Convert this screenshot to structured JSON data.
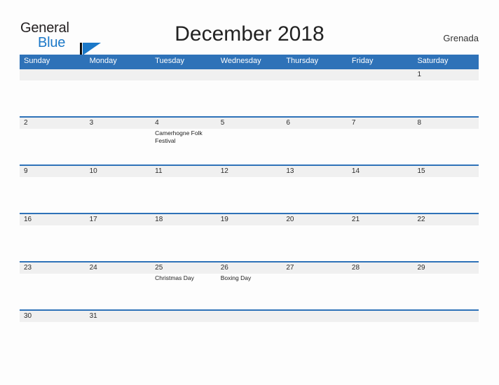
{
  "brand": {
    "word_one": "General",
    "word_two": "Blue",
    "flag_icon": "blue-flag-triangle-icon",
    "accent_color": "#1b78c8"
  },
  "header": {
    "title": "December 2018",
    "country": "Grenada"
  },
  "colors": {
    "header_blue": "#2e72b8",
    "number_band_gray": "#f0f0f0",
    "cell_white": "#fdfdfd",
    "text_dark": "#1c1c1c"
  },
  "calendar": {
    "weekday_headers": [
      "Sunday",
      "Monday",
      "Tuesday",
      "Wednesday",
      "Thursday",
      "Friday",
      "Saturday"
    ],
    "weeks": [
      {
        "short": false,
        "days": [
          {
            "number": "",
            "event": ""
          },
          {
            "number": "",
            "event": ""
          },
          {
            "number": "",
            "event": ""
          },
          {
            "number": "",
            "event": ""
          },
          {
            "number": "",
            "event": ""
          },
          {
            "number": "",
            "event": ""
          },
          {
            "number": "1",
            "event": ""
          }
        ]
      },
      {
        "short": false,
        "days": [
          {
            "number": "2",
            "event": ""
          },
          {
            "number": "3",
            "event": ""
          },
          {
            "number": "4",
            "event": "Camerhogne Folk Festival"
          },
          {
            "number": "5",
            "event": ""
          },
          {
            "number": "6",
            "event": ""
          },
          {
            "number": "7",
            "event": ""
          },
          {
            "number": "8",
            "event": ""
          }
        ]
      },
      {
        "short": false,
        "days": [
          {
            "number": "9",
            "event": ""
          },
          {
            "number": "10",
            "event": ""
          },
          {
            "number": "11",
            "event": ""
          },
          {
            "number": "12",
            "event": ""
          },
          {
            "number": "13",
            "event": ""
          },
          {
            "number": "14",
            "event": ""
          },
          {
            "number": "15",
            "event": ""
          }
        ]
      },
      {
        "short": false,
        "days": [
          {
            "number": "16",
            "event": ""
          },
          {
            "number": "17",
            "event": ""
          },
          {
            "number": "18",
            "event": ""
          },
          {
            "number": "19",
            "event": ""
          },
          {
            "number": "20",
            "event": ""
          },
          {
            "number": "21",
            "event": ""
          },
          {
            "number": "22",
            "event": ""
          }
        ]
      },
      {
        "short": false,
        "days": [
          {
            "number": "23",
            "event": ""
          },
          {
            "number": "24",
            "event": ""
          },
          {
            "number": "25",
            "event": "Christmas Day"
          },
          {
            "number": "26",
            "event": "Boxing Day"
          },
          {
            "number": "27",
            "event": ""
          },
          {
            "number": "28",
            "event": ""
          },
          {
            "number": "29",
            "event": ""
          }
        ]
      },
      {
        "short": true,
        "days": [
          {
            "number": "30",
            "event": ""
          },
          {
            "number": "31",
            "event": ""
          },
          {
            "number": "",
            "event": ""
          },
          {
            "number": "",
            "event": ""
          },
          {
            "number": "",
            "event": ""
          },
          {
            "number": "",
            "event": ""
          },
          {
            "number": "",
            "event": ""
          }
        ]
      }
    ]
  }
}
